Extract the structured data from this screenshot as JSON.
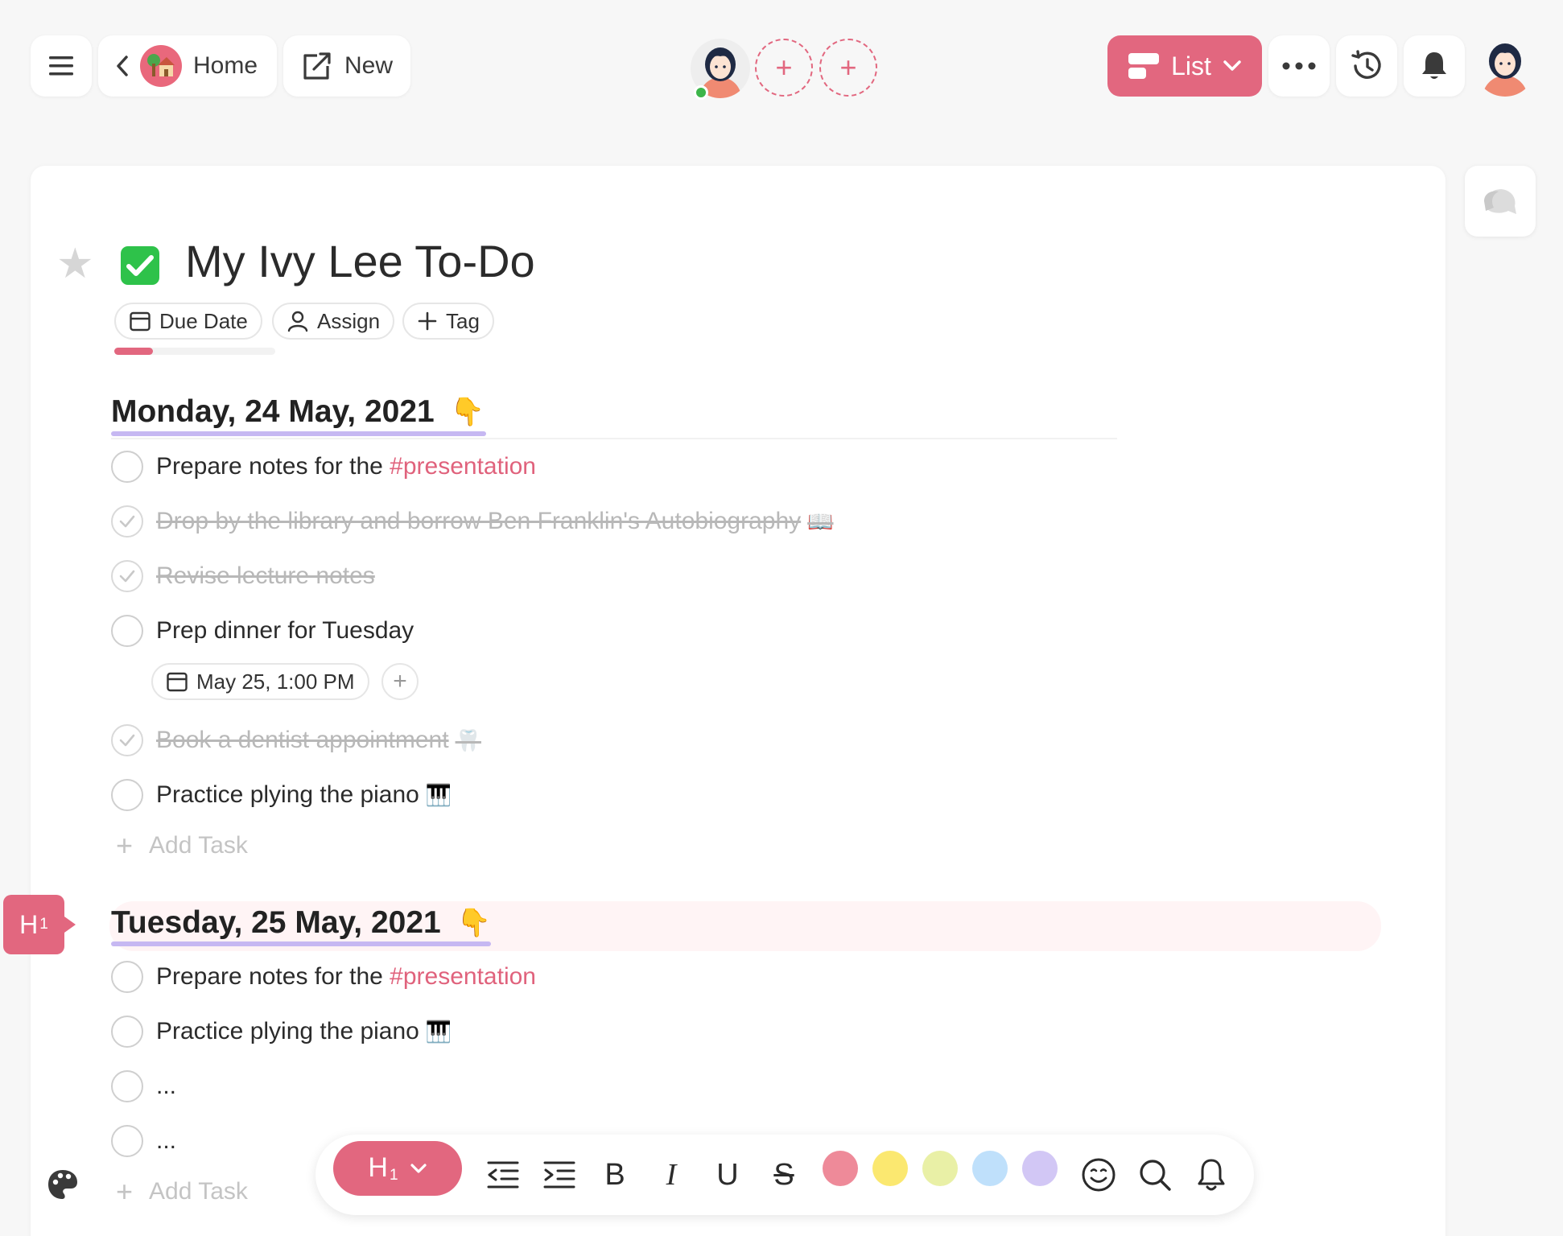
{
  "topbar": {
    "home_label": "Home",
    "new_label": "New",
    "view_label": "List"
  },
  "page": {
    "title": "My Ivy Lee To-Do",
    "progress": 0.24,
    "chips": {
      "due_date": "Due Date",
      "assign": "Assign",
      "tag": "Tag"
    }
  },
  "sections": [
    {
      "heading": "Monday, 24 May, 2021",
      "tasks": [
        {
          "text": "Prepare notes for the ",
          "hashtag": "#presentation",
          "done": false
        },
        {
          "text": "Drop by the library and borrow Ben Franklin's Autobiography",
          "emoji": "📖",
          "done": true
        },
        {
          "text": "Revise lecture notes",
          "done": true
        },
        {
          "text": "Prep dinner for Tuesday",
          "done": false,
          "due": "May 25, 1:00 PM"
        },
        {
          "text": "Book a dentist appointment",
          "emoji": "🦷",
          "done": true
        },
        {
          "text": "Practice plying the piano",
          "emoji": "🎹",
          "done": false
        }
      ],
      "add_label": "Add Task"
    },
    {
      "heading": "Tuesday, 25 May, 2021",
      "tasks": [
        {
          "text": "Prepare notes for the ",
          "hashtag": "#presentation",
          "done": false
        },
        {
          "text": "Practice plying the piano",
          "emoji": "🎹",
          "done": false
        },
        {
          "text": "...",
          "done": false
        },
        {
          "text": "...",
          "done": false
        }
      ],
      "add_label": "Add Task"
    }
  ],
  "pointing_emoji": "👇",
  "heading_marker": {
    "main": "H",
    "sub": "1"
  },
  "toolbar": {
    "heading_main": "H",
    "heading_sub": "1",
    "bold": "B",
    "italic": "I",
    "underline": "U",
    "strike": "S",
    "highlight_colors": [
      "#ee8a99",
      "#fbe870",
      "#e9f0a6",
      "#bfe0fb",
      "#d2c7f5"
    ]
  },
  "colors": {
    "accent": "#e2677f",
    "heading_underline": "#c6b8f2",
    "online": "#3db54a",
    "check_green": "#2ec24a"
  }
}
